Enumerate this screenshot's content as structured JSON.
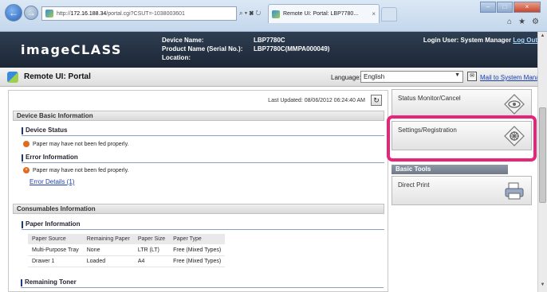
{
  "browser": {
    "url_prefix": "http://",
    "url_host": "172.16.188.34",
    "url_path": "/portal.cgi?CSUT=-1038003601",
    "addr_tools": "⌕ ▾ ✖ ↻",
    "tab_title": "Remote UI: Portal: LBP7780...",
    "tab_close": "×",
    "win_min": "–",
    "win_max": "□",
    "win_close": "×",
    "home_icon": "home-icon",
    "star_icon": "star-icon",
    "gear_icon": "gear-icon"
  },
  "header": {
    "logo": "imageCLASS",
    "device_name_label": "Device Name:",
    "product_name_label": "Product Name (Serial No.):",
    "location_label": "Location:",
    "device_name": "LBP7780C",
    "product_name": "LBP7780C(MMPA000049)",
    "location": "",
    "login_text": "Login User: System Manager",
    "logout": "Log Out"
  },
  "portal": {
    "title": "Remote UI: Portal",
    "language_label": "Language:",
    "language_value": "English",
    "mail_link": "Mail to System Manager"
  },
  "main": {
    "last_updated": "Last Updated: 08/06/2012 06:24:40 AM",
    "device_basic_info": "Device Basic Information",
    "device_status": "Device Status",
    "device_status_msg": "Paper may have not been fed properly.",
    "error_info": "Error Information",
    "error_msg": "Paper may have not been fed properly.",
    "error_details": "Error Details (1)",
    "consumables_info": "Consumables Information",
    "paper_info": "Paper Information",
    "paper_table": {
      "headers": [
        "Paper Source",
        "Remaining Paper",
        "Paper Size",
        "Paper Type"
      ],
      "rows": [
        [
          "Multi-Purpose Tray",
          "None",
          "LTR (LT)",
          "Free (Mixed Types)"
        ],
        [
          "Drawer 1",
          "Loaded",
          "A4",
          "Free (Mixed Types)"
        ]
      ]
    },
    "remaining_toner": "Remaining Toner"
  },
  "tools": {
    "status_monitor": "Status Monitor/Cancel",
    "settings": "Settings/Registration",
    "basic_tools": "Basic Tools",
    "direct_print": "Direct Print"
  },
  "colors": {
    "header_bg": "#1c2736",
    "highlight": "#e8237a",
    "link": "#1a3fb0",
    "warning": "#e26a1d"
  }
}
